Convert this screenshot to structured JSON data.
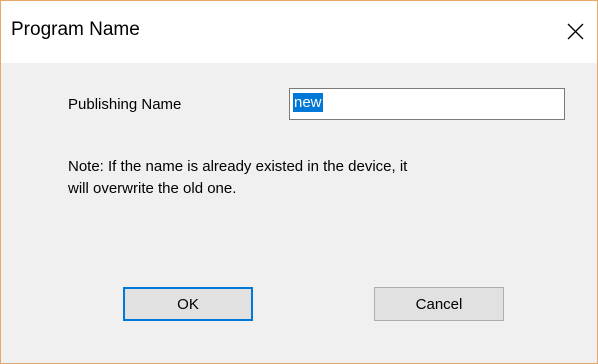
{
  "window": {
    "title": "Program Name",
    "close_icon": "close-icon"
  },
  "form": {
    "publishing_name_label": "Publishing Name",
    "publishing_name_value": "new",
    "note_line1": "Note: If the name is already existed in the device, it",
    "note_line2": "will overwrite the old one."
  },
  "buttons": {
    "ok_label": "OK",
    "cancel_label": "Cancel"
  },
  "colors": {
    "accent": "#0078d7",
    "border": "#e8a76a",
    "background": "#f0f0f0"
  }
}
